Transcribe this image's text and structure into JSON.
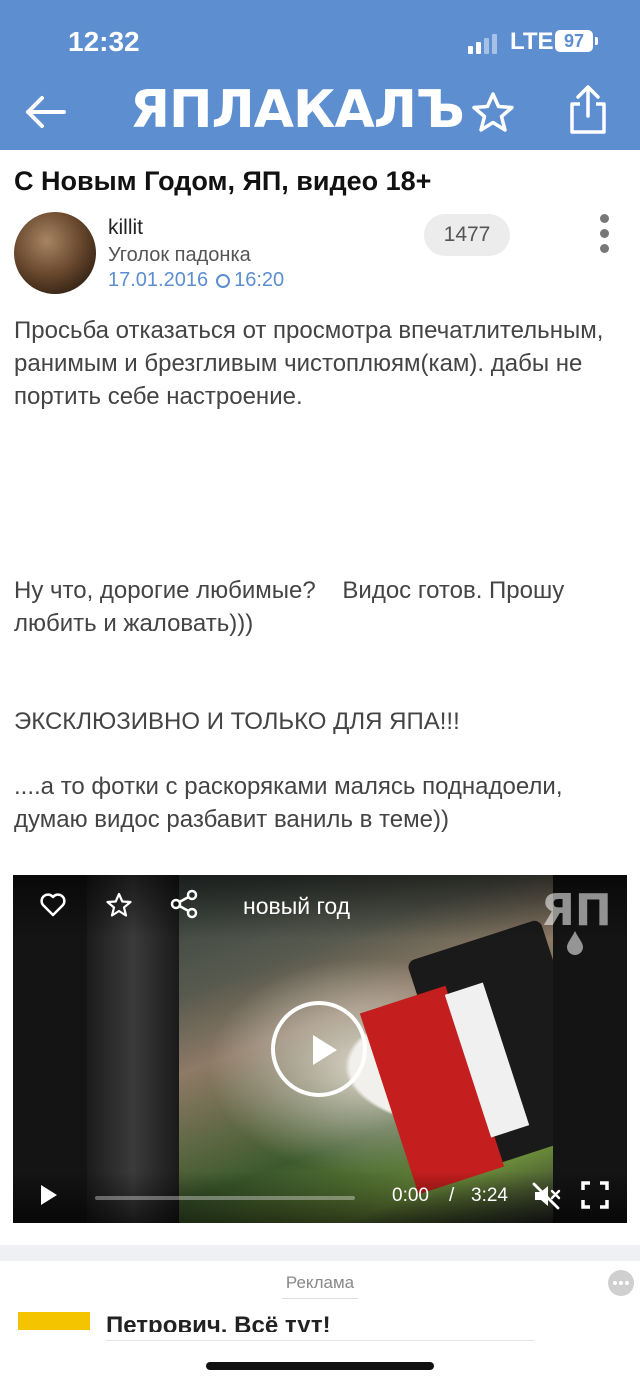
{
  "status_bar": {
    "time": "12:32",
    "network": "LTE",
    "battery": "97"
  },
  "header": {
    "logo_text": "ЯПЛАКАЛЪ",
    "icons": [
      "back-arrow-icon",
      "star-icon",
      "share-icon"
    ]
  },
  "post": {
    "title": "С Новым Годом, ЯП, видео 18+",
    "author": "killit",
    "section": "Уголок падонка",
    "date": "17.01.2016",
    "time": "16:20",
    "counter": "1477",
    "paragraphs": [
      "Просьба отказаться от просмотра впечатлительным, ранимым и брезгливым чистоплюям(кам). дабы не портить себе настроение.",
      "Ну что, дорогие любимые?    Видос готов. Прошу любить и жаловать)))",
      "ЭКСКЛЮЗИВНО И ТОЛЬКО ДЛЯ ЯПА!!!",
      "....а то фотки с раскоряками малясь поднадоели, думаю видос разбавит ваниль в теме))"
    ]
  },
  "video": {
    "title": "новый год",
    "watermark": "ЯП",
    "current_time": "0:00",
    "separator": "/",
    "duration": "3:24",
    "progress_fraction": 0.0
  },
  "ad": {
    "label": "Реклама",
    "title": "Петрович. Всё тут!"
  },
  "colors": {
    "header_blue": "#5c8ed0",
    "date_blue": "#5c8ed0",
    "ad_yellow": "#f4c400"
  }
}
